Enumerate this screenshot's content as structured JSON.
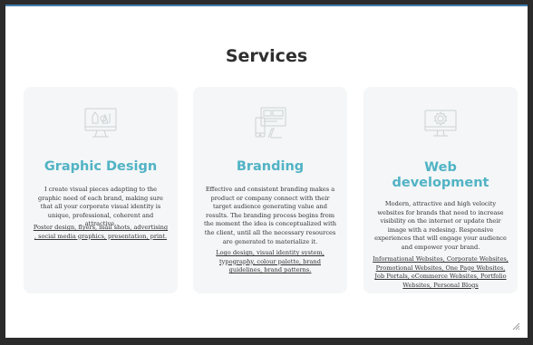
{
  "page": {
    "title": "Services"
  },
  "services": [
    {
      "icon": "monitor-design-icon",
      "title": "Graphic Design",
      "description": "I create visual pieces adapting to the graphic need of each brand, making sure that all your corporate visual identity is unique, professional, coherent and attractive.",
      "links": "Poster design, flyers, mail shots, advertising , social media graphics, presentation, print."
    },
    {
      "icon": "branding-devices-icon",
      "title": "Branding",
      "description": "Effective and consistent branding makes a product or company connect with their target audience generating value and results. The branding process begins from the moment the idea is conceptualized with the client, until all the necessary resources are generated to materialize it.",
      "links": "Logo design, visual identity system, typography, colour palette, brand guidelines, brand patterns."
    },
    {
      "icon": "monitor-gear-icon",
      "title_line1": "Web",
      "title_line2": "development",
      "description": "Modern, attractive and high velocity websites for brands that need to increase visibility on the internet or update their image with a redesing. Responsive experiences that will engage your audience and empower your brand.",
      "links": "Informational Websites, Corporate Websites, Promotional Websites, One Page Websites, Job Portals, eCommerce Websites, Portfolio Websites, Personal Blogs"
    }
  ],
  "colors": {
    "accent": "#51b3c5",
    "card_bg": "#f4f6f7",
    "title": "#2f2f2f"
  }
}
